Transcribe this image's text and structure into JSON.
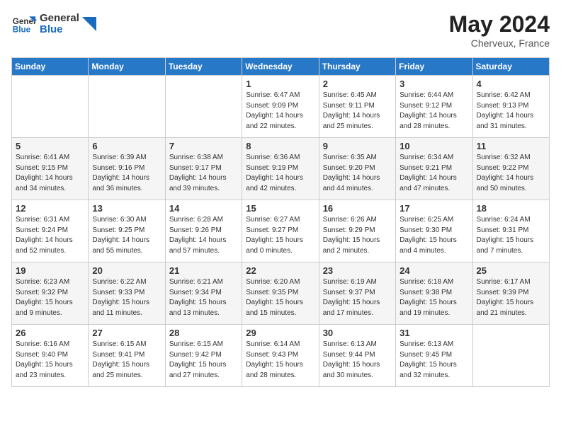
{
  "header": {
    "logo_general": "General",
    "logo_blue": "Blue",
    "month_year": "May 2024",
    "location": "Cherveux, France"
  },
  "days_of_week": [
    "Sunday",
    "Monday",
    "Tuesday",
    "Wednesday",
    "Thursday",
    "Friday",
    "Saturday"
  ],
  "weeks": [
    [
      {
        "day": "",
        "info": ""
      },
      {
        "day": "",
        "info": ""
      },
      {
        "day": "",
        "info": ""
      },
      {
        "day": "1",
        "info": "Sunrise: 6:47 AM\nSunset: 9:09 PM\nDaylight: 14 hours\nand 22 minutes."
      },
      {
        "day": "2",
        "info": "Sunrise: 6:45 AM\nSunset: 9:11 PM\nDaylight: 14 hours\nand 25 minutes."
      },
      {
        "day": "3",
        "info": "Sunrise: 6:44 AM\nSunset: 9:12 PM\nDaylight: 14 hours\nand 28 minutes."
      },
      {
        "day": "4",
        "info": "Sunrise: 6:42 AM\nSunset: 9:13 PM\nDaylight: 14 hours\nand 31 minutes."
      }
    ],
    [
      {
        "day": "5",
        "info": "Sunrise: 6:41 AM\nSunset: 9:15 PM\nDaylight: 14 hours\nand 34 minutes."
      },
      {
        "day": "6",
        "info": "Sunrise: 6:39 AM\nSunset: 9:16 PM\nDaylight: 14 hours\nand 36 minutes."
      },
      {
        "day": "7",
        "info": "Sunrise: 6:38 AM\nSunset: 9:17 PM\nDaylight: 14 hours\nand 39 minutes."
      },
      {
        "day": "8",
        "info": "Sunrise: 6:36 AM\nSunset: 9:19 PM\nDaylight: 14 hours\nand 42 minutes."
      },
      {
        "day": "9",
        "info": "Sunrise: 6:35 AM\nSunset: 9:20 PM\nDaylight: 14 hours\nand 44 minutes."
      },
      {
        "day": "10",
        "info": "Sunrise: 6:34 AM\nSunset: 9:21 PM\nDaylight: 14 hours\nand 47 minutes."
      },
      {
        "day": "11",
        "info": "Sunrise: 6:32 AM\nSunset: 9:22 PM\nDaylight: 14 hours\nand 50 minutes."
      }
    ],
    [
      {
        "day": "12",
        "info": "Sunrise: 6:31 AM\nSunset: 9:24 PM\nDaylight: 14 hours\nand 52 minutes."
      },
      {
        "day": "13",
        "info": "Sunrise: 6:30 AM\nSunset: 9:25 PM\nDaylight: 14 hours\nand 55 minutes."
      },
      {
        "day": "14",
        "info": "Sunrise: 6:28 AM\nSunset: 9:26 PM\nDaylight: 14 hours\nand 57 minutes."
      },
      {
        "day": "15",
        "info": "Sunrise: 6:27 AM\nSunset: 9:27 PM\nDaylight: 15 hours\nand 0 minutes."
      },
      {
        "day": "16",
        "info": "Sunrise: 6:26 AM\nSunset: 9:29 PM\nDaylight: 15 hours\nand 2 minutes."
      },
      {
        "day": "17",
        "info": "Sunrise: 6:25 AM\nSunset: 9:30 PM\nDaylight: 15 hours\nand 4 minutes."
      },
      {
        "day": "18",
        "info": "Sunrise: 6:24 AM\nSunset: 9:31 PM\nDaylight: 15 hours\nand 7 minutes."
      }
    ],
    [
      {
        "day": "19",
        "info": "Sunrise: 6:23 AM\nSunset: 9:32 PM\nDaylight: 15 hours\nand 9 minutes."
      },
      {
        "day": "20",
        "info": "Sunrise: 6:22 AM\nSunset: 9:33 PM\nDaylight: 15 hours\nand 11 minutes."
      },
      {
        "day": "21",
        "info": "Sunrise: 6:21 AM\nSunset: 9:34 PM\nDaylight: 15 hours\nand 13 minutes."
      },
      {
        "day": "22",
        "info": "Sunrise: 6:20 AM\nSunset: 9:35 PM\nDaylight: 15 hours\nand 15 minutes."
      },
      {
        "day": "23",
        "info": "Sunrise: 6:19 AM\nSunset: 9:37 PM\nDaylight: 15 hours\nand 17 minutes."
      },
      {
        "day": "24",
        "info": "Sunrise: 6:18 AM\nSunset: 9:38 PM\nDaylight: 15 hours\nand 19 minutes."
      },
      {
        "day": "25",
        "info": "Sunrise: 6:17 AM\nSunset: 9:39 PM\nDaylight: 15 hours\nand 21 minutes."
      }
    ],
    [
      {
        "day": "26",
        "info": "Sunrise: 6:16 AM\nSunset: 9:40 PM\nDaylight: 15 hours\nand 23 minutes."
      },
      {
        "day": "27",
        "info": "Sunrise: 6:15 AM\nSunset: 9:41 PM\nDaylight: 15 hours\nand 25 minutes."
      },
      {
        "day": "28",
        "info": "Sunrise: 6:15 AM\nSunset: 9:42 PM\nDaylight: 15 hours\nand 27 minutes."
      },
      {
        "day": "29",
        "info": "Sunrise: 6:14 AM\nSunset: 9:43 PM\nDaylight: 15 hours\nand 28 minutes."
      },
      {
        "day": "30",
        "info": "Sunrise: 6:13 AM\nSunset: 9:44 PM\nDaylight: 15 hours\nand 30 minutes."
      },
      {
        "day": "31",
        "info": "Sunrise: 6:13 AM\nSunset: 9:45 PM\nDaylight: 15 hours\nand 32 minutes."
      },
      {
        "day": "",
        "info": ""
      }
    ]
  ]
}
